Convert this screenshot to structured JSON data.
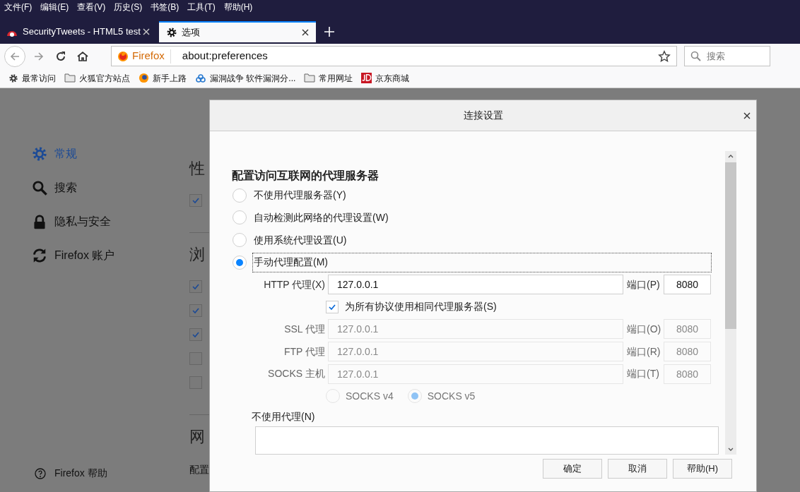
{
  "menu_bar": [
    "文件(F)",
    "编辑(E)",
    "查看(V)",
    "历史(S)",
    "书签(B)",
    "工具(T)",
    "帮助(H)"
  ],
  "tabs": [
    {
      "label": "SecurityTweets - HTML5 test",
      "selected": false,
      "kind": "site"
    },
    {
      "label": "选项",
      "selected": true,
      "kind": "settings"
    }
  ],
  "address_bar": {
    "identity": "Firefox",
    "url": "about:preferences"
  },
  "search": {
    "placeholder": "搜索"
  },
  "bookmarks": [
    {
      "label": "最常访问",
      "kind": "gear"
    },
    {
      "label": "火狐官方站点",
      "kind": "folder"
    },
    {
      "label": "新手上路",
      "kind": "firefox"
    },
    {
      "label": "漏洞战争 软件漏洞分...",
      "kind": "cloud"
    },
    {
      "label": "常用网址",
      "kind": "folder"
    },
    {
      "label": "京东商城",
      "kind": "jd"
    }
  ],
  "sidebar": {
    "items": [
      {
        "label": "常规",
        "kind": "gear",
        "selected": true
      },
      {
        "label": "搜索",
        "kind": "search",
        "selected": false
      },
      {
        "label": "隐私与安全",
        "kind": "lock",
        "selected": false
      },
      {
        "label": "Firefox 账户",
        "kind": "sync",
        "selected": false
      }
    ],
    "help": "Firefox 帮助"
  },
  "page_sections": [
    {
      "heading": "性",
      "options": [
        {
          "checked": true
        }
      ]
    },
    {
      "heading": "浏",
      "options": [
        {
          "checked": true
        },
        {
          "checked": true
        },
        {
          "checked": true
        },
        {
          "checked": false
        },
        {
          "checked": false
        }
      ]
    },
    {
      "heading": "网",
      "text": "配置"
    }
  ],
  "dialog": {
    "title": "连接设置",
    "heading": "配置访问互联网的代理服务器",
    "modes": [
      {
        "label": "不使用代理服务器(Y)",
        "selected": false
      },
      {
        "label": "自动检测此网络的代理设置(W)",
        "selected": false
      },
      {
        "label": "使用系统代理设置(U)",
        "selected": false
      },
      {
        "label": "手动代理配置(M)",
        "selected": true
      }
    ],
    "proxies": [
      {
        "label": "HTTP 代理(X)",
        "value": "127.0.0.1",
        "port_label": "端口(P)",
        "port": "8080",
        "disabled": false
      },
      {
        "kind": "share",
        "label": "为所有协议使用相同代理服务器(S)",
        "checked": true
      },
      {
        "label": "SSL 代理",
        "value": "127.0.0.1",
        "port_label": "端口(O)",
        "port": "8080",
        "disabled": true
      },
      {
        "label": "FTP 代理",
        "value": "127.0.0.1",
        "port_label": "端口(R)",
        "port": "8080",
        "disabled": true
      },
      {
        "label": "SOCKS 主机",
        "value": "127.0.0.1",
        "port_label": "端口(T)",
        "port": "8080",
        "disabled": true
      }
    ],
    "socks_versions": [
      {
        "label": "SOCKS v4",
        "selected": false,
        "disabled": true
      },
      {
        "label": "SOCKS v5",
        "selected": true,
        "disabled": true
      }
    ],
    "no_proxy": {
      "label": "不使用代理(N)"
    },
    "buttons": [
      "确定",
      "取消",
      "帮助(H)"
    ]
  }
}
